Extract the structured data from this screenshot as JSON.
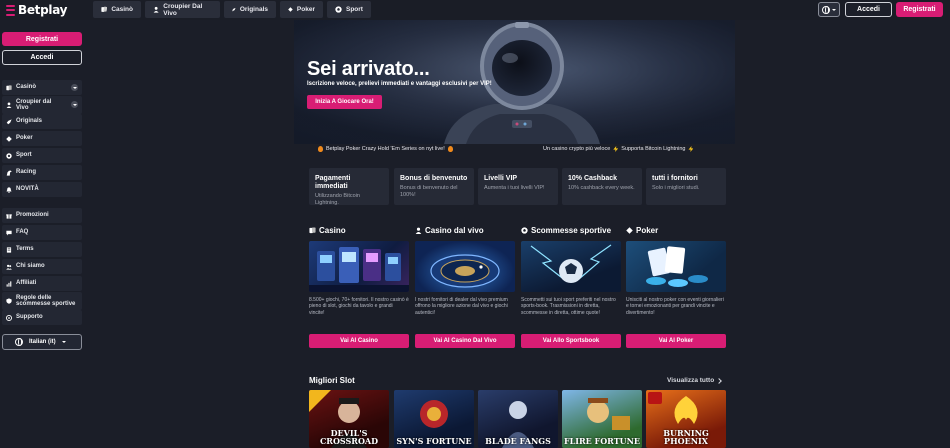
{
  "brand": {
    "name": "Betplay",
    "accent": "#d81d74"
  },
  "topnav": [
    {
      "label": "Casinò",
      "icon": "cards-icon"
    },
    {
      "label": "Croupier Dal Vivo",
      "icon": "dealer-icon"
    },
    {
      "label": "Originals",
      "icon": "rocket-icon"
    },
    {
      "label": "Poker",
      "icon": "diamond-icon"
    },
    {
      "label": "Sport",
      "icon": "football-icon"
    }
  ],
  "header": {
    "login_label": "Accedi",
    "register_label": "Registrati"
  },
  "sidebar": {
    "register_label": "Registrati",
    "login_label": "Accedi",
    "items": [
      {
        "label": "Casinò",
        "icon": "cards-icon"
      },
      {
        "label": "Croupier dal Vivo",
        "icon": "dealer-icon"
      },
      {
        "label": "Originals",
        "icon": "rocket-icon"
      },
      {
        "label": "Poker",
        "icon": "diamond-icon"
      },
      {
        "label": "Sport",
        "icon": "football-icon"
      },
      {
        "label": "Racing",
        "icon": "horse-icon"
      },
      {
        "label": "NOVITÀ",
        "icon": "bell-icon"
      }
    ],
    "items2": [
      {
        "label": "Promozioni",
        "icon": "gift-icon"
      },
      {
        "label": "FAQ",
        "icon": "chat-icon"
      },
      {
        "label": "Terms",
        "icon": "document-icon"
      },
      {
        "label": "Chi siamo",
        "icon": "users-icon"
      },
      {
        "label": "Affiliati",
        "icon": "chart-icon"
      },
      {
        "label": "Regole delle scommesse sportive",
        "icon": "rules-icon"
      },
      {
        "label": "Supporto",
        "icon": "support-icon"
      }
    ],
    "language_label": "Italian (it)"
  },
  "hero": {
    "title": "Sei arrivato...",
    "subtitle": "Iscrizione veloce, prelievi immediati e vantaggi esclusivi per VIP!",
    "cta": "Inizia A Giocare Ora!"
  },
  "ticker": {
    "left": "Betplay Poker Crazy Hold 'Em Series on nyt live!",
    "right_1": "Un casino crypto più veloce",
    "right_2": "Supporta Bitcoin Lightning"
  },
  "features": [
    {
      "title": "Pagamenti immediati",
      "desc": "Utilizzando Bitcoin Lightning."
    },
    {
      "title": "Bonus di benvenuto",
      "desc": "Bonus di benvenuto del 100%!"
    },
    {
      "title": "Livelli VIP",
      "desc": "Aumenta i tuoi livelli VIP!"
    },
    {
      "title": "10% Cashback",
      "desc": "10% cashback every week."
    },
    {
      "title": "tutti i fornitori",
      "desc": "Solo i migliori studi."
    }
  ],
  "categories": [
    {
      "title": "Casino",
      "icon": "cards-icon",
      "desc": "8.500+ giochi, 70+ fornitori. Il nostro casinò è pieno di slot, giochi da tavolo e grandi vincite!",
      "button": "Vai Al Casino"
    },
    {
      "title": "Casino dal vivo",
      "icon": "dealer-icon",
      "desc": "I nostri fornitori di dealer dal vivo premium offrono la migliore azione dal vivo e giochi autentici!",
      "button": "Vai Al Casino Dal Vivo"
    },
    {
      "title": "Scommesse sportive",
      "icon": "football-icon",
      "desc": "Scommetti sui tuoi sport preferiti nel nostro sports-book. Trasmissioni in diretta, scommesse in diretta, ottime quote!",
      "button": "Vai Allo Sportsbook"
    },
    {
      "title": "Poker",
      "icon": "diamond-icon",
      "desc": "Unisciti al nostro poker con eventi giornalieri e tornei emozionanti per grandi vincite e divertimento!",
      "button": "Vai Al Poker"
    }
  ],
  "slots": {
    "title": "Migliori Slot",
    "view_all": "Visualizza tutto",
    "items": [
      {
        "name": "DEVIL'S CROSSROAD"
      },
      {
        "name": "SYN'S FORTUNE"
      },
      {
        "name": "BLADE FANGS"
      },
      {
        "name": "FLIRE FORTUNE"
      },
      {
        "name": "BURNING PHOENIX"
      }
    ]
  }
}
